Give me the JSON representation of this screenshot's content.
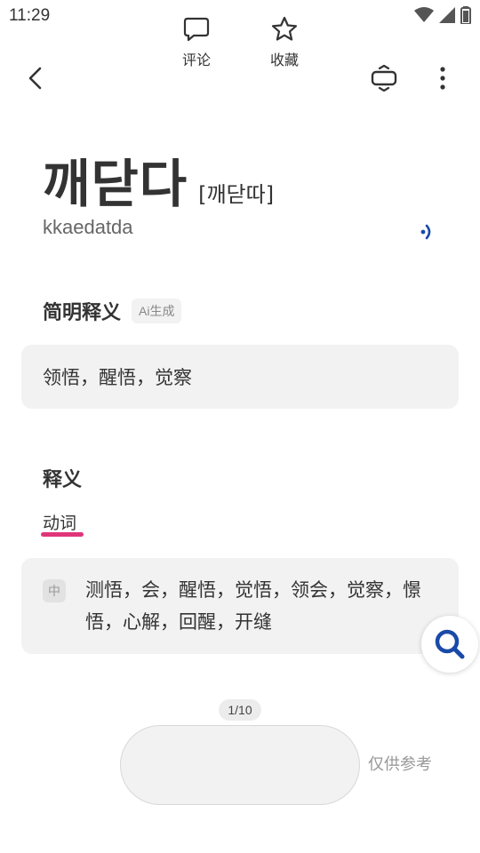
{
  "status_bar": {
    "time": "11:29"
  },
  "entry": {
    "headword": "깨닫다",
    "pronunciation": "[깨닫따]",
    "romanization": "kkaedatda"
  },
  "brief": {
    "title": "简明释义",
    "badge": "Ai生成",
    "text": "领悟，醒悟，觉察"
  },
  "definition": {
    "title": "释义",
    "pos": "动词",
    "lang_tag": "中",
    "text": "测悟，会，醒悟，觉悟，领会，觉察，憬悟，心解，回醒，开缝"
  },
  "pager": {
    "label": "1/10"
  },
  "actions": {
    "comment": "评论",
    "favorite": "收藏"
  },
  "disclaimer": "仅供参考",
  "colors": {
    "accent_pink": "#e0357a",
    "accent_blue": "#1a4aa8"
  }
}
